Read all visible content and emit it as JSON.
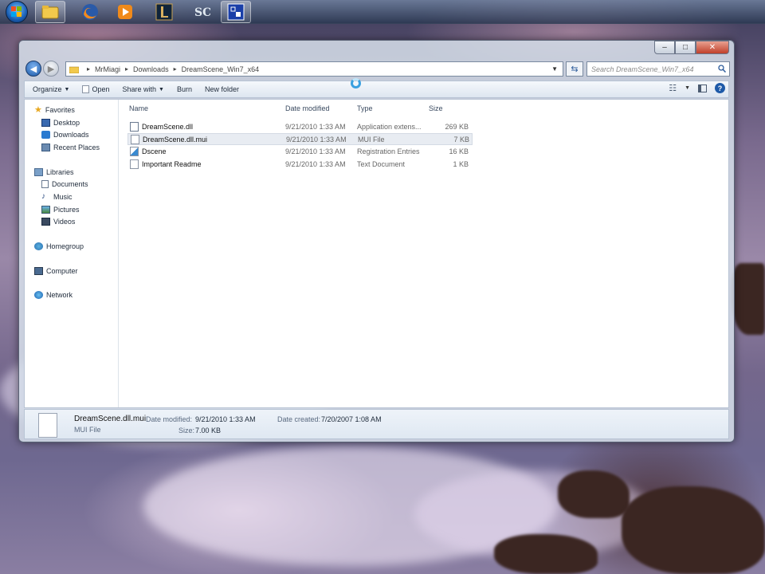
{
  "taskbar": {
    "items": [
      {
        "name": "start-button"
      },
      {
        "name": "explorer-taskbar-button",
        "active": true
      },
      {
        "name": "firefox-taskbar-button"
      },
      {
        "name": "media-player-taskbar-button"
      },
      {
        "name": "league-of-legends-taskbar-button"
      },
      {
        "name": "starcraft-taskbar-button"
      },
      {
        "name": "app-taskbar-button",
        "active": true
      }
    ]
  },
  "window": {
    "caption": {
      "minimize": "–",
      "maximize": "□",
      "close": "✕"
    },
    "breadcrumbs": [
      "MrMiagi",
      "Downloads",
      "DreamScene_Win7_x64"
    ],
    "search_placeholder": "Search DreamScene_Win7_x64",
    "toolbar": {
      "organize": "Organize",
      "open": "Open",
      "share_with": "Share with",
      "burn": "Burn",
      "new_folder": "New folder"
    },
    "nav": {
      "favorites": "Favorites",
      "desktop": "Desktop",
      "downloads": "Downloads",
      "recent_places": "Recent Places",
      "libraries": "Libraries",
      "documents": "Documents",
      "music": "Music",
      "pictures": "Pictures",
      "videos": "Videos",
      "homegroup": "Homegroup",
      "computer": "Computer",
      "network": "Network"
    },
    "columns": {
      "name": "Name",
      "date_modified": "Date modified",
      "type": "Type",
      "size": "Size"
    },
    "files": [
      {
        "name": "DreamScene.dll",
        "date": "9/21/2010 1:33 AM",
        "type": "Application extens...",
        "size": "269 KB"
      },
      {
        "name": "DreamScene.dll.mui",
        "date": "9/21/2010 1:33 AM",
        "type": "MUI File",
        "size": "7 KB",
        "selected": true
      },
      {
        "name": "Dscene",
        "date": "9/21/2010 1:33 AM",
        "type": "Registration Entries",
        "size": "16 KB"
      },
      {
        "name": "Important Readme",
        "date": "9/21/2010 1:33 AM",
        "type": "Text Document",
        "size": "1 KB"
      }
    ],
    "details": {
      "file_name": "DreamScene.dll.mui",
      "file_type": "MUI File",
      "date_modified_label": "Date modified:",
      "date_modified": "9/21/2010 1:33 AM",
      "size_label": "Size:",
      "size": "7.00 KB",
      "date_created_label": "Date created:",
      "date_created": "7/20/2007 1:08 AM"
    }
  },
  "colors": {
    "window_frame": "#d7e1eb",
    "selection": "#e8ecf2",
    "link_blue": "#1a5fb4"
  }
}
